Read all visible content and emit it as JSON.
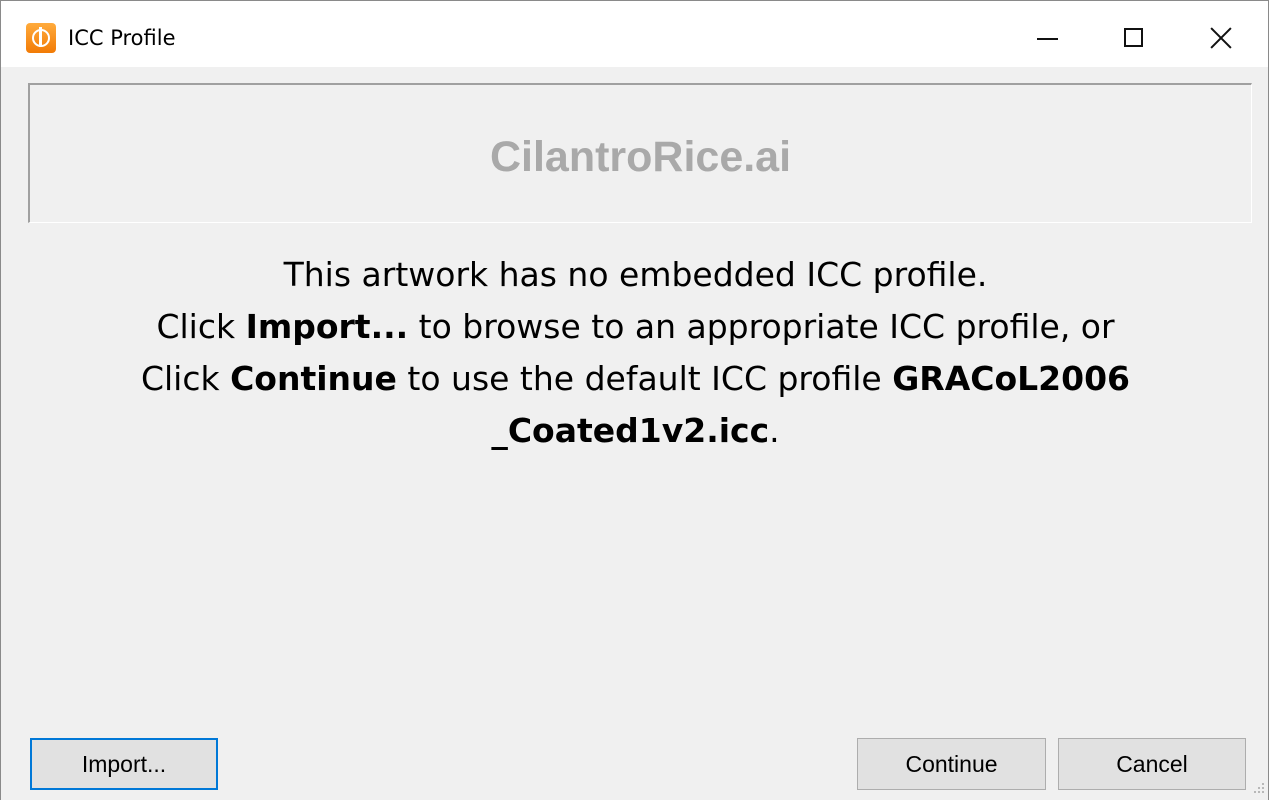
{
  "window": {
    "title": "ICC Profile",
    "controls": {
      "minimize": "minimize-icon",
      "maximize": "maximize-icon",
      "close": "close-icon"
    },
    "app_icon": "app-logo-icon",
    "accent_color": "#0078d7",
    "icon_color": "#f27b05"
  },
  "banner": {
    "text": "CilantroRice.ai",
    "text_color": "#a9a9a9"
  },
  "message": {
    "line1": "This artwork has no embedded ICC profile.",
    "line2": {
      "prefix": "Click ",
      "bold": "Import...",
      "suffix": " to browse to an appropriate ICC profile, or"
    },
    "line3": {
      "prefix": "Click ",
      "bold": "Continue",
      "middle": " to use the default ICC profile ",
      "bold2": "GRACoL2006"
    },
    "line4": {
      "bold": "_Coated1v2.icc",
      "suffix": "."
    }
  },
  "buttons": {
    "import": "Import...",
    "continue": "Continue",
    "cancel": "Cancel"
  }
}
